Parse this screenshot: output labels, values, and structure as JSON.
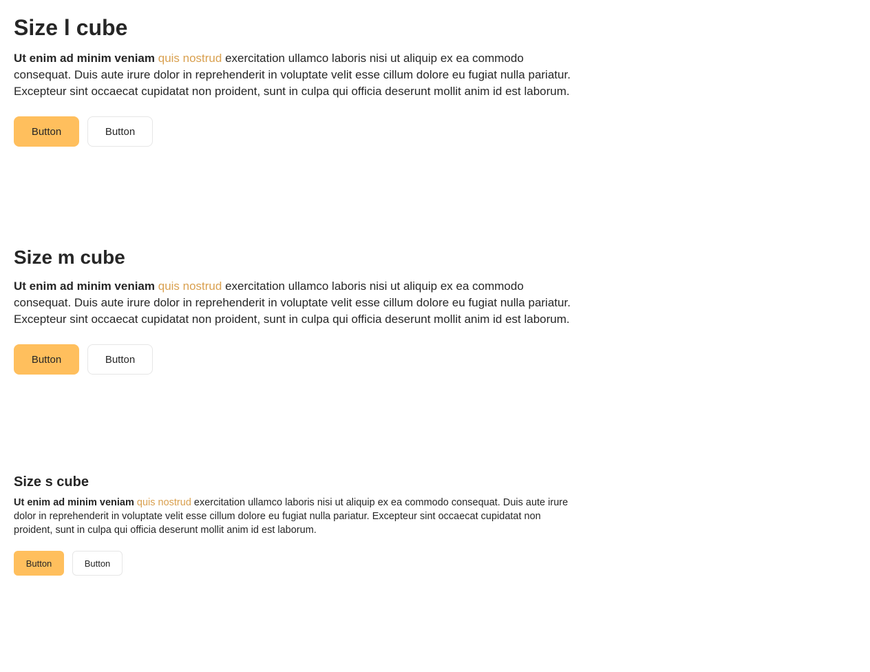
{
  "cubes": {
    "l": {
      "title": "Size l cube",
      "bold": "Ut enim ad minim veniam",
      "highlight": "quis nostrud",
      "rest": " exercitation ullamco laboris nisi ut aliquip ex ea commodo consequat. Duis aute irure dolor in reprehenderit in voluptate velit esse cillum dolore eu fugiat nulla pariatur. Excepteur sint occaecat cupidatat non proident, sunt in culpa qui officia deserunt mollit anim id est laborum.",
      "primary_button": "Button",
      "secondary_button": "Button"
    },
    "m": {
      "title": "Size m cube",
      "bold": "Ut enim ad minim veniam",
      "highlight": "quis nostrud",
      "rest": " exercitation ullamco laboris nisi ut aliquip ex ea commodo consequat. Duis aute irure dolor in reprehenderit in voluptate velit esse cillum dolore eu fugiat nulla pariatur. Excepteur sint occaecat cupidatat non proident, sunt in culpa qui officia deserunt mollit anim id est laborum.",
      "primary_button": "Button",
      "secondary_button": "Button"
    },
    "s": {
      "title": "Size s cube",
      "bold": "Ut enim ad minim veniam",
      "highlight": "quis nostrud",
      "rest": " exercitation ullamco laboris nisi ut aliquip ex ea commodo consequat. Duis aute irure dolor in reprehenderit in voluptate velit esse cillum dolore eu fugiat nulla pariatur. Excepteur sint occaecat cupidatat non proident, sunt in culpa qui officia deserunt mollit anim id est laborum.",
      "primary_button": "Button",
      "secondary_button": "Button"
    }
  },
  "colors": {
    "primary_button_bg": "#ffbf5d",
    "highlight_text": "#d9a04f",
    "text": "#262626",
    "secondary_border": "#e6e6e6"
  }
}
